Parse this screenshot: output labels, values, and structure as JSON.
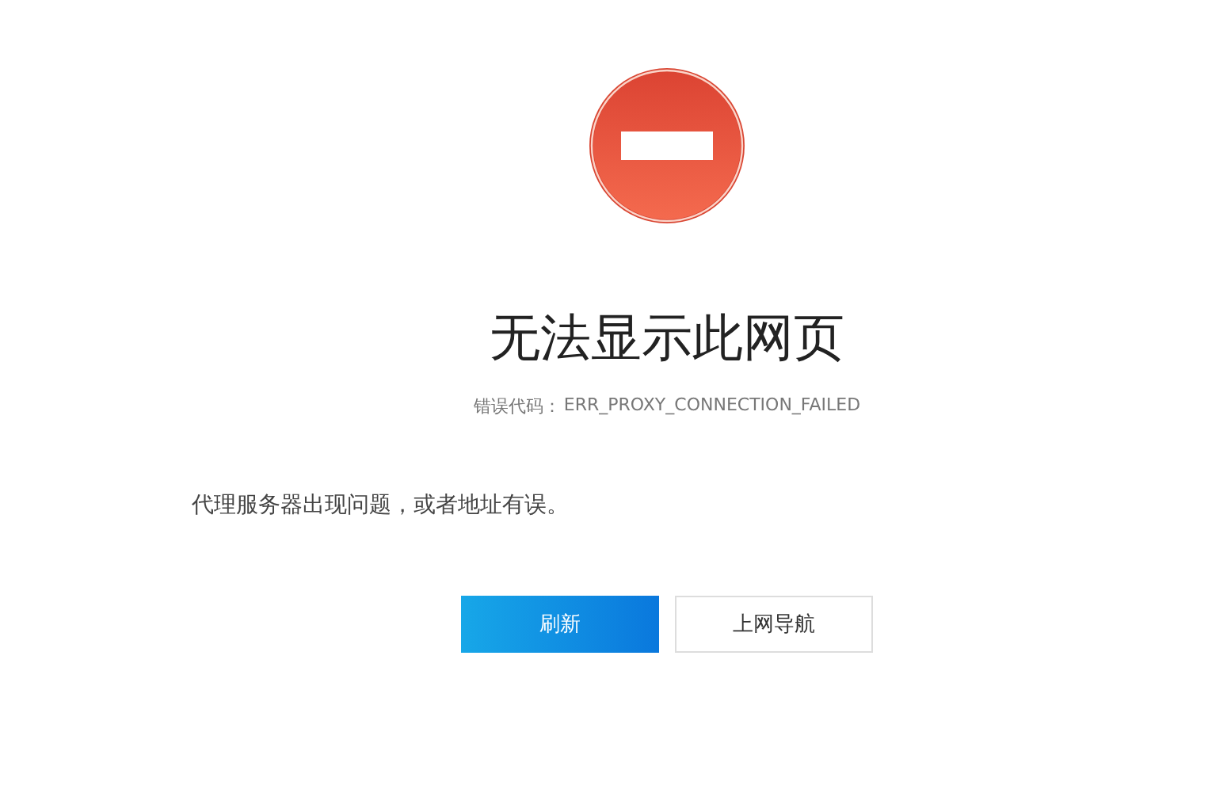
{
  "error": {
    "title": "无法显示此网页",
    "code_label": "错误代码：",
    "code": "ERR_PROXY_CONNECTION_FAILED"
  },
  "message": "代理服务器出现问题，或者地址有误。",
  "buttons": [
    {
      "label": "刷新",
      "kind": "primary"
    },
    {
      "label": "上网导航",
      "kind": "secondary"
    }
  ]
}
